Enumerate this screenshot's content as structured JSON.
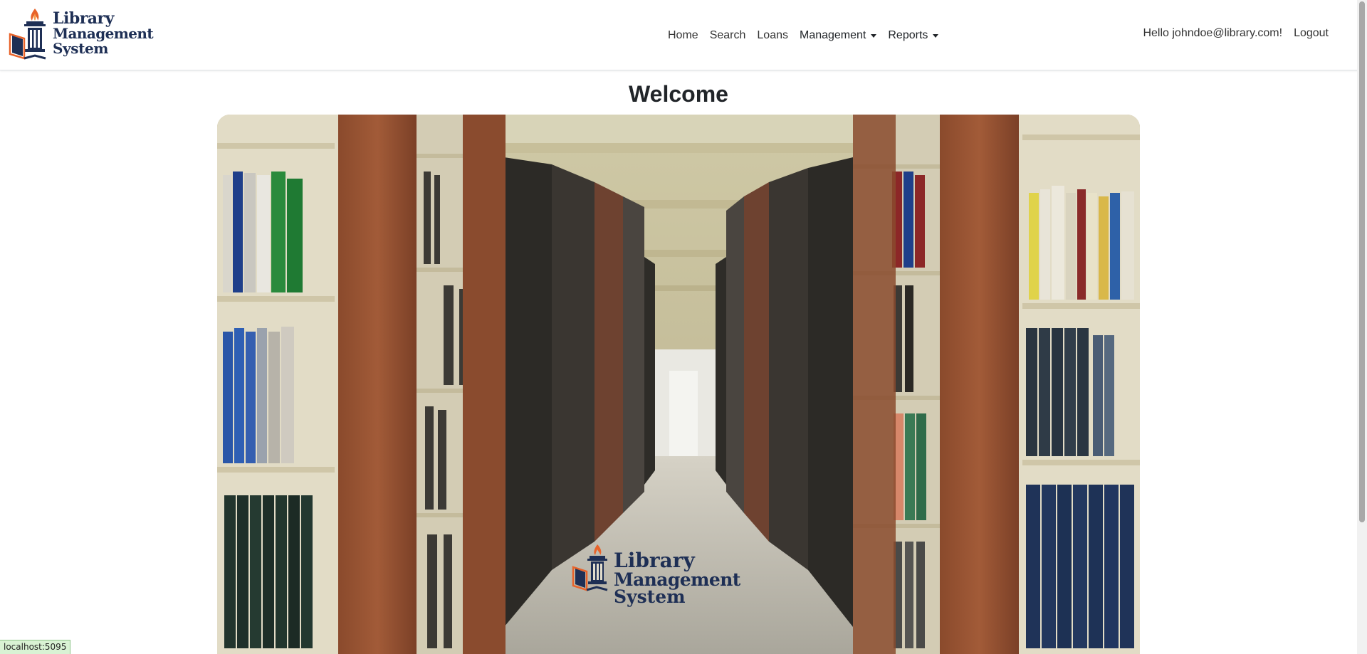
{
  "brand": {
    "line1": "Library",
    "line2": "Management",
    "line3": "System",
    "logo_icon": "torch-column-book-icon"
  },
  "nav": {
    "items": [
      {
        "label": "Home"
      },
      {
        "label": "Search"
      },
      {
        "label": "Loans"
      }
    ],
    "dropdowns": [
      {
        "label": "Management"
      },
      {
        "label": "Reports"
      }
    ]
  },
  "user": {
    "greeting": "Hello johndoe@library.com!",
    "logout_label": "Logout"
  },
  "main": {
    "title": "Welcome",
    "hero_image": "library-aisle-bookshelves-photo",
    "hero_logo": {
      "line1": "Library",
      "line2": "Management",
      "line3": "System"
    }
  },
  "status_bar": {
    "url": "localhost:5095"
  },
  "colors": {
    "brand_navy": "#1e2f55",
    "flame_orange": "#e8632a",
    "navbar_bg": "#ffffff"
  }
}
